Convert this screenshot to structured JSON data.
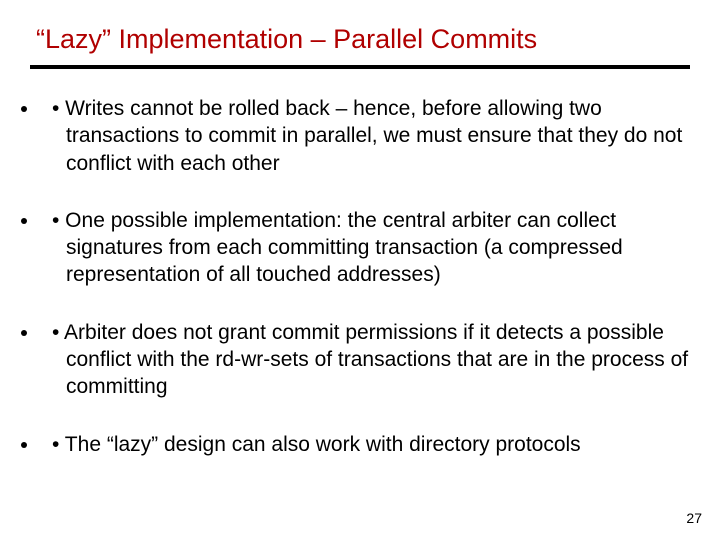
{
  "title": "“Lazy” Implementation – Parallel Commits",
  "bullets": [
    "• Writes cannot be rolled back – hence, before allowing two transactions to commit in parallel, we must ensure that they do not conflict with each other",
    "• One possible implementation: the central arbiter can collect signatures from each committing transaction (a compressed representation of all touched addresses)",
    "• Arbiter does not grant commit permissions if it detects a possible conflict with the rd-wr-sets of transactions that are in the process of committing",
    "• The “lazy” design can also work with directory protocols"
  ],
  "pagenum": "27"
}
